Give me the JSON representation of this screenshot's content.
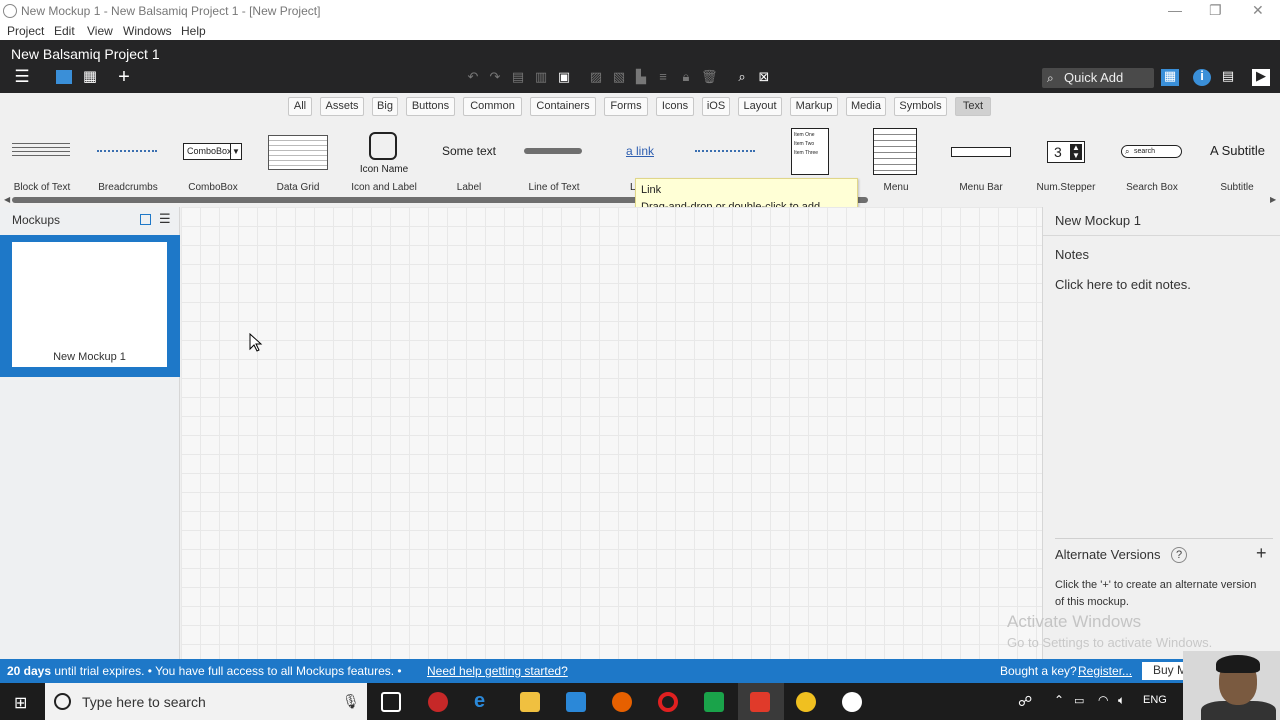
{
  "window": {
    "title": "New Mockup 1 - New Balsamiq Project 1 - [New Project]"
  },
  "menu": [
    "Project",
    "Edit",
    "View",
    "Windows",
    "Help"
  ],
  "header": {
    "project_name": "New Balsamiq Project 1",
    "quick_add": "Quick Add"
  },
  "filters": [
    "All",
    "Assets",
    "Big",
    "Buttons",
    "Common",
    "Containers",
    "Forms",
    "Icons",
    "iOS",
    "Layout",
    "Markup",
    "Media",
    "Symbols",
    "Text"
  ],
  "filters_selected": "Text",
  "library": {
    "items": [
      "Block of Text",
      "Breadcrumbs",
      "ComboBox",
      "Data Grid",
      "Icon and Label",
      "Label",
      "Line of Text",
      "L",
      "",
      "",
      "Menu",
      "Menu Bar",
      "Num.Stepper",
      "Search Box",
      "Subtitle"
    ],
    "combobox_text": "ComboBox",
    "icon_name_text": "Icon Name",
    "label_text": "Some text",
    "link_text": "a link",
    "numstepper_value": "3",
    "searchbox_placeholder": "search",
    "subtitle_text": "A Subtitle",
    "list_items": [
      "Item One",
      "Item Two",
      "Item Three"
    ]
  },
  "tooltip": {
    "title": "Link",
    "text": "Drag-and-drop or double-click to add"
  },
  "left_panel": {
    "title": "Mockups",
    "thumbnail_label": "New Mockup 1"
  },
  "right_panel": {
    "mockup_name": "New Mockup 1",
    "notes_title": "Notes",
    "notes_placeholder": "Click here to edit notes.",
    "alt_title": "Alternate Versions",
    "alt_help": "?",
    "alt_desc": "Click the '+' to create an alternate version of this mockup."
  },
  "watermark": {
    "line1": "Activate Windows",
    "line2": "Go to Settings to activate Windows."
  },
  "status": {
    "days": "20 days",
    "trial": " until trial expires.  •  You have full access to all Mockups features.  •",
    "help": "Need help getting started?",
    "key": "Bought a key?",
    "register": "Register...",
    "buy": "Buy M"
  },
  "taskbar": {
    "search_placeholder": "Type here to search",
    "lang": "ENG"
  },
  "colors": {
    "accent": "#1e78c8",
    "header_bg": "#252526",
    "tooltip_bg": "#ffffd6"
  }
}
